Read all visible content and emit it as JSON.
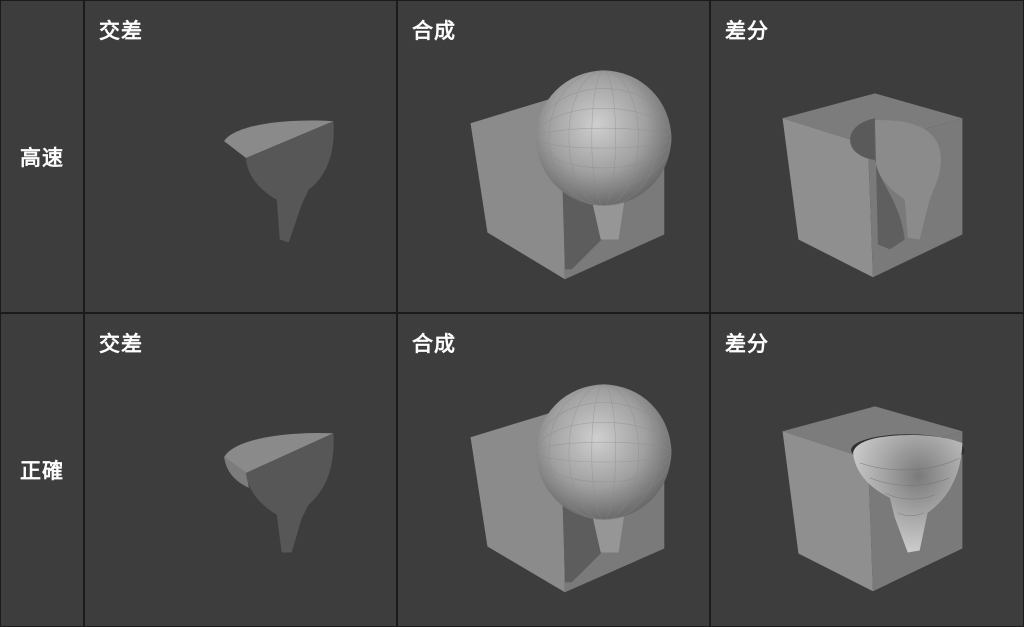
{
  "rows": [
    {
      "label": "高速",
      "columns": [
        "交差",
        "合成",
        "差分"
      ]
    },
    {
      "label": "正確",
      "columns": [
        "交差",
        "合成",
        "差分"
      ]
    }
  ],
  "colors": {
    "background": "#3d3d3d",
    "border": "#1b1b1b",
    "mesh_light": "#9a9a9a",
    "mesh_mid": "#7f7f7f",
    "mesh_dark": "#5c5c5c",
    "text": "#ffffff"
  }
}
